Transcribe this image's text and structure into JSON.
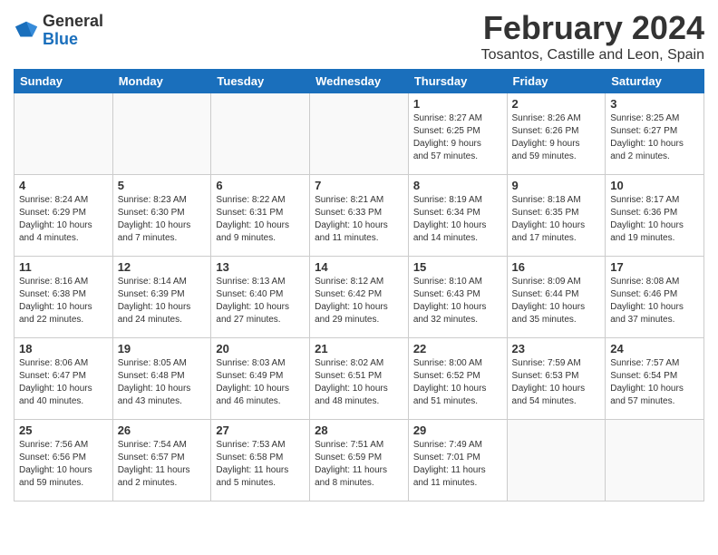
{
  "logo": {
    "general": "General",
    "blue": "Blue"
  },
  "title": {
    "month": "February 2024",
    "location": "Tosantos, Castille and Leon, Spain"
  },
  "weekdays": [
    "Sunday",
    "Monday",
    "Tuesday",
    "Wednesday",
    "Thursday",
    "Friday",
    "Saturday"
  ],
  "weeks": [
    [
      {
        "day": "",
        "info": ""
      },
      {
        "day": "",
        "info": ""
      },
      {
        "day": "",
        "info": ""
      },
      {
        "day": "",
        "info": ""
      },
      {
        "day": "1",
        "info": "Sunrise: 8:27 AM\nSunset: 6:25 PM\nDaylight: 9 hours\nand 57 minutes."
      },
      {
        "day": "2",
        "info": "Sunrise: 8:26 AM\nSunset: 6:26 PM\nDaylight: 9 hours\nand 59 minutes."
      },
      {
        "day": "3",
        "info": "Sunrise: 8:25 AM\nSunset: 6:27 PM\nDaylight: 10 hours\nand 2 minutes."
      }
    ],
    [
      {
        "day": "4",
        "info": "Sunrise: 8:24 AM\nSunset: 6:29 PM\nDaylight: 10 hours\nand 4 minutes."
      },
      {
        "day": "5",
        "info": "Sunrise: 8:23 AM\nSunset: 6:30 PM\nDaylight: 10 hours\nand 7 minutes."
      },
      {
        "day": "6",
        "info": "Sunrise: 8:22 AM\nSunset: 6:31 PM\nDaylight: 10 hours\nand 9 minutes."
      },
      {
        "day": "7",
        "info": "Sunrise: 8:21 AM\nSunset: 6:33 PM\nDaylight: 10 hours\nand 11 minutes."
      },
      {
        "day": "8",
        "info": "Sunrise: 8:19 AM\nSunset: 6:34 PM\nDaylight: 10 hours\nand 14 minutes."
      },
      {
        "day": "9",
        "info": "Sunrise: 8:18 AM\nSunset: 6:35 PM\nDaylight: 10 hours\nand 17 minutes."
      },
      {
        "day": "10",
        "info": "Sunrise: 8:17 AM\nSunset: 6:36 PM\nDaylight: 10 hours\nand 19 minutes."
      }
    ],
    [
      {
        "day": "11",
        "info": "Sunrise: 8:16 AM\nSunset: 6:38 PM\nDaylight: 10 hours\nand 22 minutes."
      },
      {
        "day": "12",
        "info": "Sunrise: 8:14 AM\nSunset: 6:39 PM\nDaylight: 10 hours\nand 24 minutes."
      },
      {
        "day": "13",
        "info": "Sunrise: 8:13 AM\nSunset: 6:40 PM\nDaylight: 10 hours\nand 27 minutes."
      },
      {
        "day": "14",
        "info": "Sunrise: 8:12 AM\nSunset: 6:42 PM\nDaylight: 10 hours\nand 29 minutes."
      },
      {
        "day": "15",
        "info": "Sunrise: 8:10 AM\nSunset: 6:43 PM\nDaylight: 10 hours\nand 32 minutes."
      },
      {
        "day": "16",
        "info": "Sunrise: 8:09 AM\nSunset: 6:44 PM\nDaylight: 10 hours\nand 35 minutes."
      },
      {
        "day": "17",
        "info": "Sunrise: 8:08 AM\nSunset: 6:46 PM\nDaylight: 10 hours\nand 37 minutes."
      }
    ],
    [
      {
        "day": "18",
        "info": "Sunrise: 8:06 AM\nSunset: 6:47 PM\nDaylight: 10 hours\nand 40 minutes."
      },
      {
        "day": "19",
        "info": "Sunrise: 8:05 AM\nSunset: 6:48 PM\nDaylight: 10 hours\nand 43 minutes."
      },
      {
        "day": "20",
        "info": "Sunrise: 8:03 AM\nSunset: 6:49 PM\nDaylight: 10 hours\nand 46 minutes."
      },
      {
        "day": "21",
        "info": "Sunrise: 8:02 AM\nSunset: 6:51 PM\nDaylight: 10 hours\nand 48 minutes."
      },
      {
        "day": "22",
        "info": "Sunrise: 8:00 AM\nSunset: 6:52 PM\nDaylight: 10 hours\nand 51 minutes."
      },
      {
        "day": "23",
        "info": "Sunrise: 7:59 AM\nSunset: 6:53 PM\nDaylight: 10 hours\nand 54 minutes."
      },
      {
        "day": "24",
        "info": "Sunrise: 7:57 AM\nSunset: 6:54 PM\nDaylight: 10 hours\nand 57 minutes."
      }
    ],
    [
      {
        "day": "25",
        "info": "Sunrise: 7:56 AM\nSunset: 6:56 PM\nDaylight: 10 hours\nand 59 minutes."
      },
      {
        "day": "26",
        "info": "Sunrise: 7:54 AM\nSunset: 6:57 PM\nDaylight: 11 hours\nand 2 minutes."
      },
      {
        "day": "27",
        "info": "Sunrise: 7:53 AM\nSunset: 6:58 PM\nDaylight: 11 hours\nand 5 minutes."
      },
      {
        "day": "28",
        "info": "Sunrise: 7:51 AM\nSunset: 6:59 PM\nDaylight: 11 hours\nand 8 minutes."
      },
      {
        "day": "29",
        "info": "Sunrise: 7:49 AM\nSunset: 7:01 PM\nDaylight: 11 hours\nand 11 minutes."
      },
      {
        "day": "",
        "info": ""
      },
      {
        "day": "",
        "info": ""
      }
    ]
  ]
}
